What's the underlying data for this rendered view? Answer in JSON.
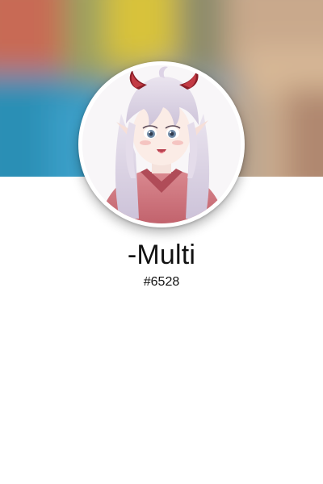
{
  "profile": {
    "username": "-Multi",
    "discriminator": "#6528",
    "banner_description": "blurred-colorful-banner",
    "avatar_description": "anime-character-with-horns"
  },
  "colors": {
    "background": "#ffffff",
    "text": "#111111",
    "ring": "#ffffff"
  }
}
